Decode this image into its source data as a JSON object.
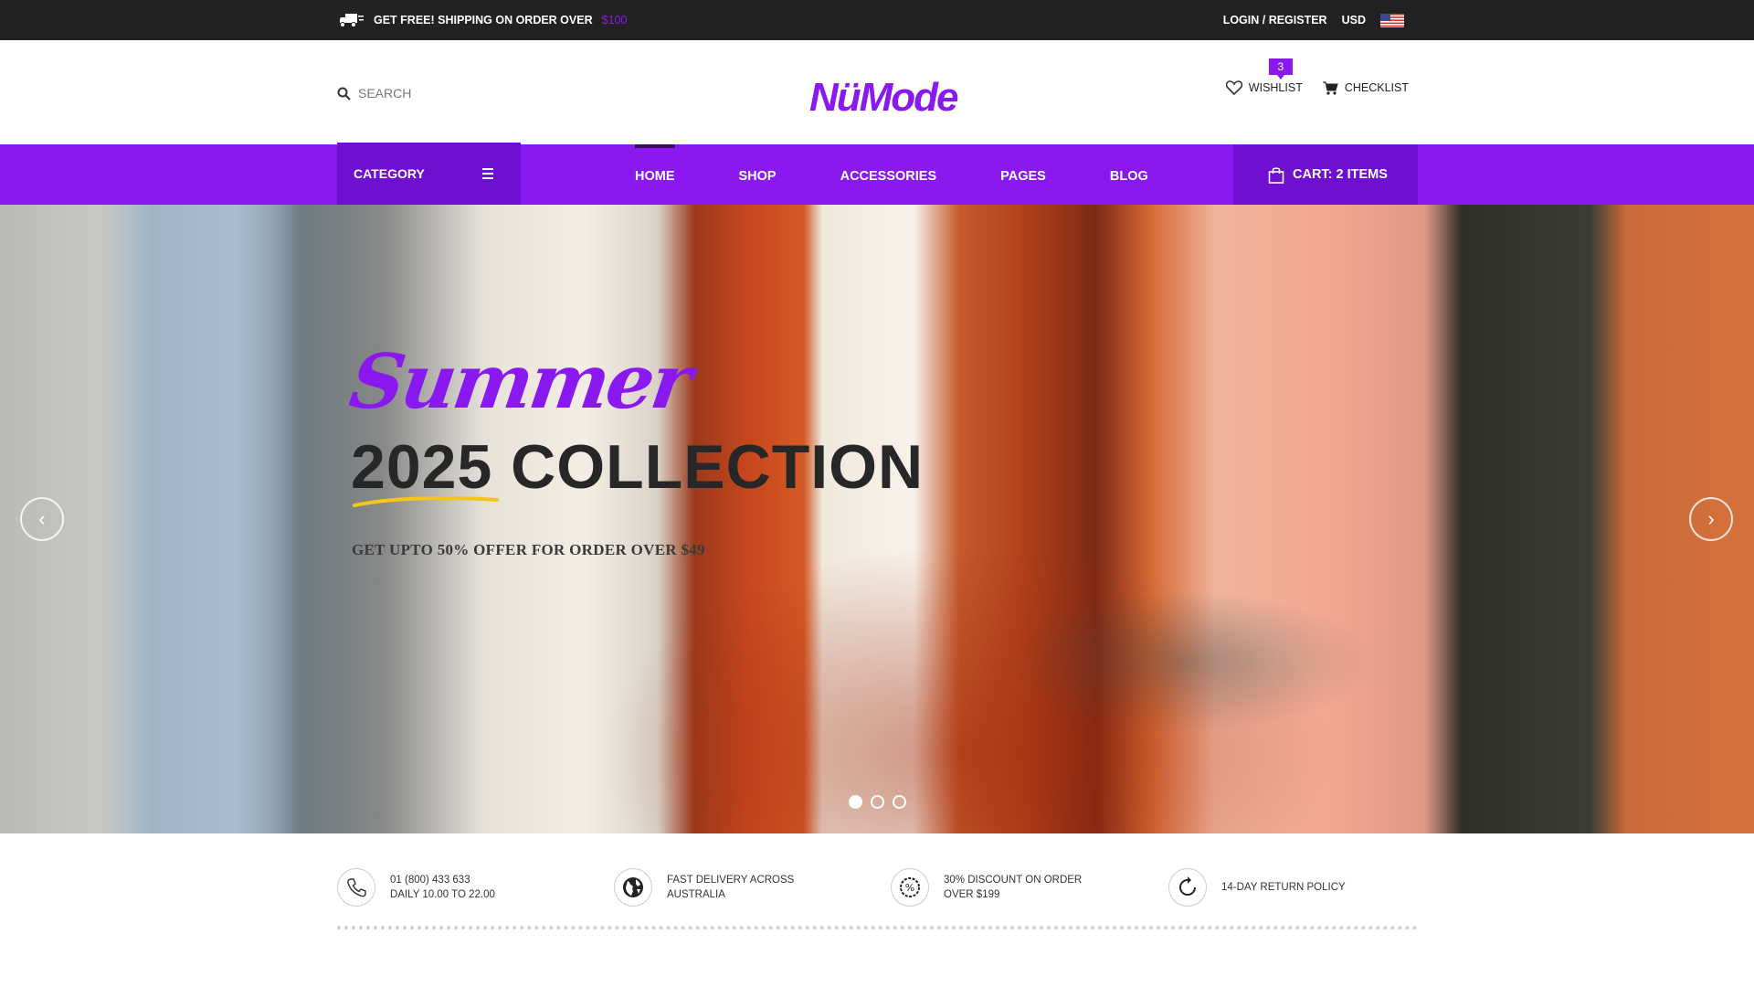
{
  "topbar": {
    "shipping_text": "GET FREE! SHIPPING ON ORDER OVER",
    "shipping_amount": "$100",
    "login": "LOGIN / REGISTER",
    "currency": "USD"
  },
  "header": {
    "search_placeholder": "SEARCH",
    "logo": "NüMode",
    "wishlist_label": "WISHLIST",
    "wishlist_count": "3",
    "checklist_label": "CHECKLIST"
  },
  "nav": {
    "category_label": "CATEGORY",
    "items": [
      {
        "label": "HOME"
      },
      {
        "label": "SHOP"
      },
      {
        "label": "ACCESSORIES"
      },
      {
        "label": "PAGES"
      },
      {
        "label": "BLOG"
      }
    ],
    "cart_label": "CART: 2 ITEMS"
  },
  "hero": {
    "script_title": "Summer",
    "headline": "2025 COLLECTION",
    "subtitle": "GET UPTO 50% OFFER FOR ORDER OVER $49",
    "active_slide": 1,
    "slide_count": 3
  },
  "features": [
    {
      "icon": "phone-icon",
      "line1": "01 (800) 433 633",
      "line2": "DAILY 10.00 TO 22.00"
    },
    {
      "icon": "globe-icon",
      "line1": "FAST DELIVERY ACROSS",
      "line2": "AUSTRALIA"
    },
    {
      "icon": "percent-badge-icon",
      "line1": "30% DISCOUNT ON ORDER",
      "line2": "OVER $199"
    },
    {
      "icon": "return-icon",
      "line1": "14-DAY RETURN POLICY",
      "line2": ""
    }
  ],
  "colors": {
    "accent": "#8a19f0",
    "accent_dark": "#6f0fd0",
    "topbar": "#222222"
  }
}
